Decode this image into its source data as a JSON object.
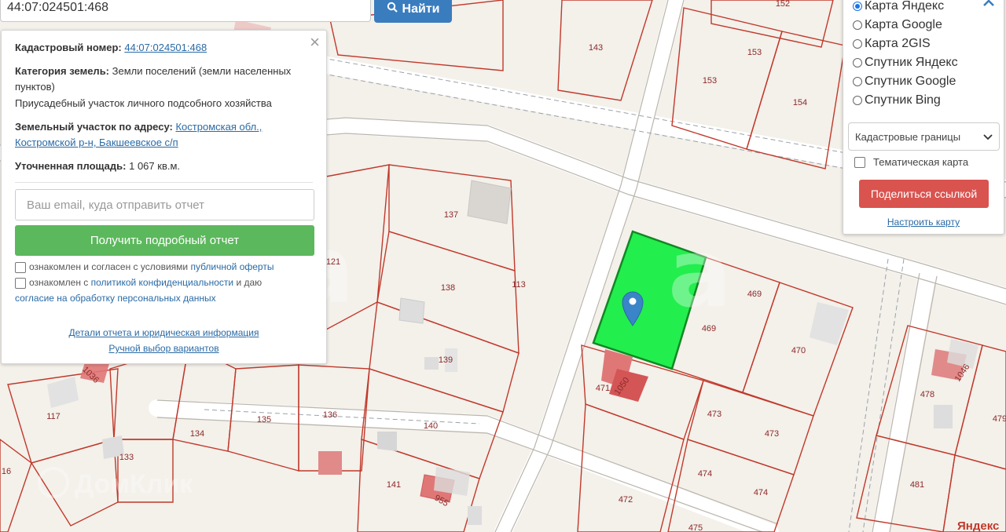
{
  "search": {
    "value": "44:07:024501:468",
    "button_label": "Найти",
    "button_icon": "search-icon"
  },
  "info": {
    "cadastral_label": "Кадастровый номер:",
    "cadastral_value": "44:07:024501:468",
    "category_label": "Категория земель:",
    "category_value": "Земли поселений (земли населенных пунктов)",
    "usage": "Приусадебный участок личного подсобного хозяйства",
    "address_label": "Земельный участок по адресу:",
    "address_line1": "Костромская обл.,",
    "address_line2": "Костромской р-н, Бакшеевское с/п",
    "area_label": "Уточненная площадь:",
    "area_value": "1 067 кв.м.",
    "email_placeholder": "Ваш email, куда отправить отчет",
    "get_report_label": "Получить подробный отчет",
    "agree1_text": "ознакомлен и согласен с условиями",
    "agree1_link": "публичной оферты",
    "agree2_text1": "ознакомлен с",
    "agree2_link1": "политикой конфиденциальности",
    "agree2_text2": "и даю",
    "agree2_link2": "согласие на обработку персональных данных",
    "details_link": "Детали отчета и юридическая информация",
    "manual_link": "Ручной выбор вариантов"
  },
  "layers": {
    "options": [
      {
        "label": "Карта Яндекс",
        "selected": true
      },
      {
        "label": "Карта Google",
        "selected": false
      },
      {
        "label": "Карта 2GIS",
        "selected": false
      },
      {
        "label": "Спутник Яндекс",
        "selected": false
      },
      {
        "label": "Спутник Google",
        "selected": false
      },
      {
        "label": "Спутник Bing",
        "selected": false
      }
    ],
    "select_value": "Кадастровые границы",
    "thematic_label": "Тематическая карта",
    "share_label": "Поделиться ссылкой",
    "config_label": "Настроить карту"
  },
  "map": {
    "parcel_labels": [
      "143",
      "152",
      "153",
      "153",
      "154",
      "137",
      "138",
      "113",
      "121",
      "139",
      "1036",
      "117",
      "134",
      "135",
      "136",
      "140",
      "133",
      "141",
      "955",
      "16",
      "469",
      "469",
      "470",
      "1050",
      "471",
      "473",
      "473",
      "474",
      "474",
      "472",
      "478",
      "1046",
      "479",
      "481",
      "475"
    ],
    "watermark": "ДомКлик",
    "corner_text": "Яндекс",
    "accent_green": "#22e84a",
    "accent_blue": "#3a7dbf",
    "accent_red": "#d9534f"
  }
}
